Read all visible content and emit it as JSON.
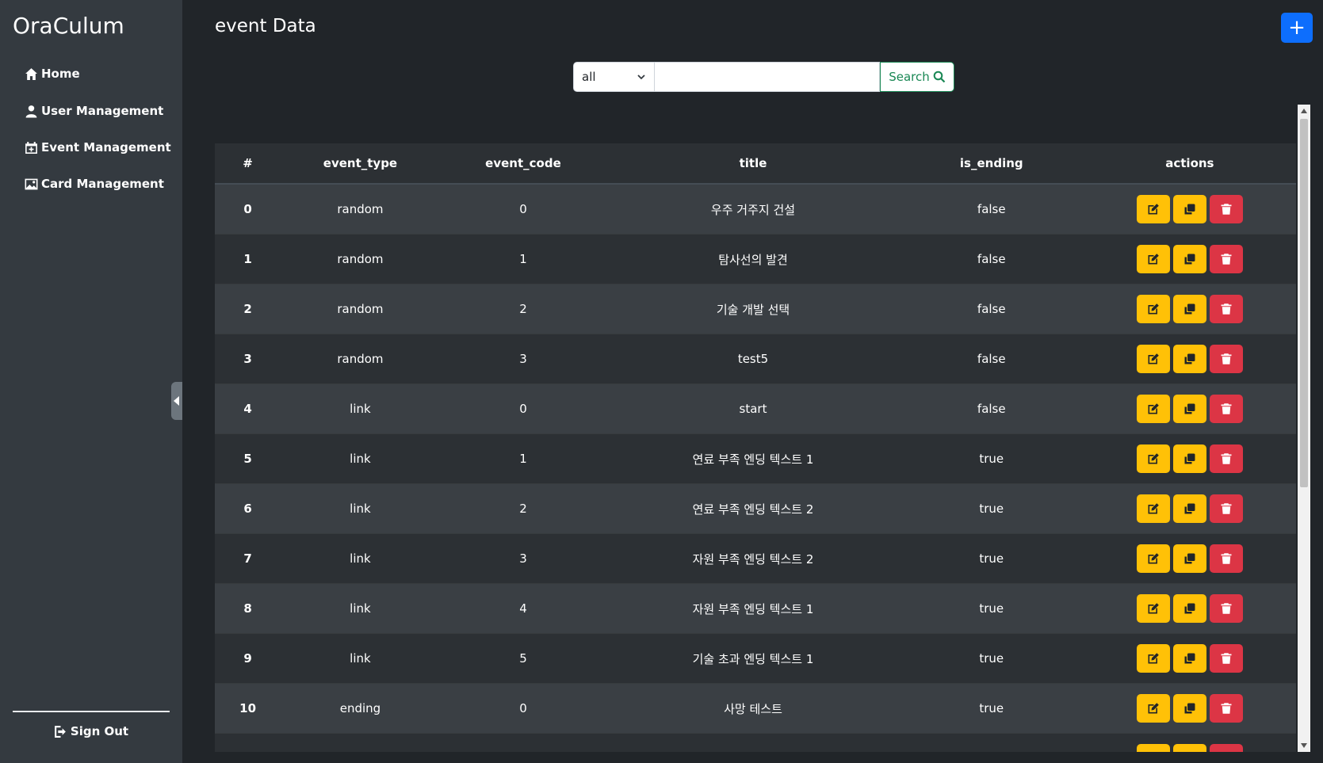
{
  "app": {
    "brand": "OraCulum"
  },
  "sidebar": {
    "items": [
      {
        "label": "Home",
        "icon": "home-icon"
      },
      {
        "label": "User Management",
        "icon": "user-icon"
      },
      {
        "label": "Event Management",
        "icon": "calendar-plus-icon"
      },
      {
        "label": "Card Management",
        "icon": "image-icon"
      }
    ],
    "signout_label": "Sign Out"
  },
  "header": {
    "title": "event Data",
    "add_label": "+"
  },
  "search": {
    "selected": "all",
    "value": "",
    "button_label": "Search"
  },
  "table": {
    "columns": [
      "#",
      "event_type",
      "event_code",
      "title",
      "is_ending",
      "actions"
    ],
    "rows": [
      {
        "idx": "0",
        "event_type": "random",
        "event_code": "0",
        "title": "우주 거주지 건설",
        "is_ending": "false"
      },
      {
        "idx": "1",
        "event_type": "random",
        "event_code": "1",
        "title": "탐사선의 발견",
        "is_ending": "false"
      },
      {
        "idx": "2",
        "event_type": "random",
        "event_code": "2",
        "title": "기술 개발 선택",
        "is_ending": "false"
      },
      {
        "idx": "3",
        "event_type": "random",
        "event_code": "3",
        "title": "test5",
        "is_ending": "false"
      },
      {
        "idx": "4",
        "event_type": "link",
        "event_code": "0",
        "title": "start",
        "is_ending": "false"
      },
      {
        "idx": "5",
        "event_type": "link",
        "event_code": "1",
        "title": "연료 부족 엔딩 텍스트 1",
        "is_ending": "true"
      },
      {
        "idx": "6",
        "event_type": "link",
        "event_code": "2",
        "title": "연료 부족 엔딩 텍스트 2",
        "is_ending": "true"
      },
      {
        "idx": "7",
        "event_type": "link",
        "event_code": "3",
        "title": "자원 부족 엔딩 텍스트 2",
        "is_ending": "true"
      },
      {
        "idx": "8",
        "event_type": "link",
        "event_code": "4",
        "title": "자원 부족 엔딩 텍스트 1",
        "is_ending": "true"
      },
      {
        "idx": "9",
        "event_type": "link",
        "event_code": "5",
        "title": "기술 초과 엔딩 텍스트 1",
        "is_ending": "true"
      },
      {
        "idx": "10",
        "event_type": "ending",
        "event_code": "0",
        "title": "사망 테스트",
        "is_ending": "true"
      },
      {
        "idx": "",
        "event_type": "",
        "event_code": "",
        "title": "",
        "is_ending": ""
      }
    ]
  },
  "colors": {
    "background": "#212529",
    "sidebar": "#343a40",
    "primary": "#0d6efd",
    "warning": "#ffc107",
    "danger": "#dc3545",
    "success": "#198754"
  }
}
